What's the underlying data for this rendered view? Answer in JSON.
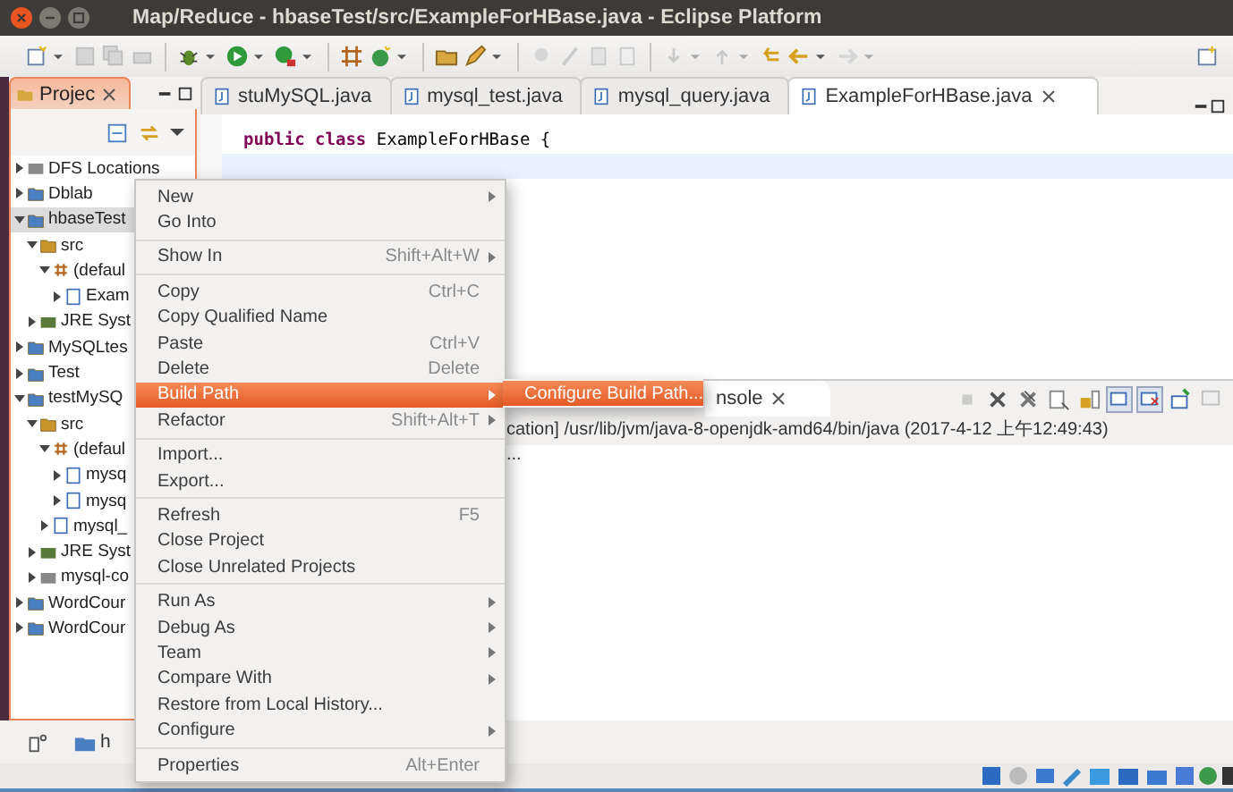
{
  "window": {
    "title": "Map/Reduce - hbaseTest/src/ExampleForHBase.java - Eclipse Platform"
  },
  "project_explorer": {
    "tab": {
      "label": "Projec",
      "selected": true
    },
    "tree": [
      {
        "label": "DFS Locations",
        "kind": "dfs",
        "expanded": false,
        "selected": false
      },
      {
        "label": "Dblab",
        "kind": "project",
        "expanded": false,
        "selected": false
      },
      {
        "label": "hbaseTest",
        "kind": "project",
        "expanded": true,
        "selected": true,
        "children": [
          {
            "label": "src",
            "kind": "source-folder",
            "expanded": true,
            "selected": false,
            "children": [
              {
                "label": "(defaul",
                "kind": "package",
                "expanded": true,
                "selected": false,
                "children": [
                  {
                    "label": "Exam",
                    "kind": "java-file",
                    "expanded": false,
                    "selected": false
                  }
                ]
              }
            ]
          },
          {
            "label": "JRE Syst",
            "kind": "library",
            "expanded": false,
            "selected": false
          }
        ]
      },
      {
        "label": "MySQLtes",
        "kind": "project",
        "expanded": false,
        "selected": false
      },
      {
        "label": "Test",
        "kind": "project",
        "expanded": false,
        "selected": false
      },
      {
        "label": "testMySQ",
        "kind": "project",
        "expanded": true,
        "selected": false,
        "children": [
          {
            "label": "src",
            "kind": "source-folder",
            "expanded": true,
            "selected": false,
            "children": [
              {
                "label": "(defaul",
                "kind": "package",
                "expanded": true,
                "selected": false,
                "children": [
                  {
                    "label": "mysq",
                    "kind": "java-file",
                    "expanded": false,
                    "selected": false
                  },
                  {
                    "label": "mysq",
                    "kind": "java-file",
                    "expanded": false,
                    "selected": false
                  }
                ]
              },
              {
                "label": "mysql_",
                "kind": "java-file",
                "expanded": false,
                "selected": false
              }
            ]
          },
          {
            "label": "JRE Syst",
            "kind": "library",
            "expanded": false,
            "selected": false
          },
          {
            "label": "mysql-co",
            "kind": "jar",
            "expanded": false,
            "selected": false
          }
        ]
      },
      {
        "label": "WordCour",
        "kind": "project",
        "expanded": false,
        "selected": false
      },
      {
        "label": "WordCour",
        "kind": "project",
        "expanded": false,
        "selected": false
      }
    ]
  },
  "editor": {
    "tabs": [
      {
        "label": "stuMySQL.java",
        "selected": false
      },
      {
        "label": "mysql_test.java",
        "selected": false
      },
      {
        "label": "mysql_query.java",
        "selected": false
      },
      {
        "label": "ExampleForHBase.java",
        "selected": true
      }
    ],
    "lines": [
      {
        "highlighted": false,
        "tokens": [
          {
            "text": "public",
            "kind": "keyword"
          },
          {
            "text": "class",
            "kind": "keyword"
          },
          {
            "text": "ExampleForHBase {",
            "kind": "plain"
          }
        ]
      },
      {
        "highlighted": true
      }
    ]
  },
  "console": {
    "tab": {
      "label": "nsole",
      "selected": true
    },
    "header": "cation] /usr/lib/jvm/java-8-openjdk-amd64/bin/java (2017-4-12 上午12:49:43)",
    "output": "..."
  },
  "status_bar": {
    "label": "h"
  },
  "context_menu": [
    {
      "kind": "item",
      "label": "New",
      "submenu": true,
      "selected": false
    },
    {
      "kind": "item",
      "label": "Go Into",
      "submenu": false,
      "selected": false
    },
    {
      "kind": "separator"
    },
    {
      "kind": "item",
      "label": "Show In",
      "shortcut": "Shift+Alt+W",
      "submenu": true,
      "selected": false
    },
    {
      "kind": "separator"
    },
    {
      "kind": "item",
      "label": "Copy",
      "shortcut": "Ctrl+C",
      "submenu": false,
      "selected": false
    },
    {
      "kind": "item",
      "label": "Copy Qualified Name",
      "submenu": false,
      "selected": false
    },
    {
      "kind": "item",
      "label": "Paste",
      "shortcut": "Ctrl+V",
      "submenu": false,
      "selected": false
    },
    {
      "kind": "item",
      "label": "Delete",
      "shortcut": "Delete",
      "submenu": false,
      "selected": false
    },
    {
      "kind": "item",
      "label": "Build Path",
      "submenu": true,
      "selected": true
    },
    {
      "kind": "item",
      "label": "Refactor",
      "shortcut": "Shift+Alt+T",
      "submenu": true,
      "selected": false
    },
    {
      "kind": "separator"
    },
    {
      "kind": "item",
      "label": "Import...",
      "submenu": false,
      "selected": false
    },
    {
      "kind": "item",
      "label": "Export...",
      "submenu": false,
      "selected": false
    },
    {
      "kind": "separator"
    },
    {
      "kind": "item",
      "label": "Refresh",
      "shortcut": "F5",
      "submenu": false,
      "selected": false
    },
    {
      "kind": "item",
      "label": "Close Project",
      "submenu": false,
      "selected": false
    },
    {
      "kind": "item",
      "label": "Close Unrelated Projects",
      "submenu": false,
      "selected": false
    },
    {
      "kind": "separator"
    },
    {
      "kind": "item",
      "label": "Run As",
      "submenu": true,
      "selected": false
    },
    {
      "kind": "item",
      "label": "Debug As",
      "submenu": true,
      "selected": false
    },
    {
      "kind": "item",
      "label": "Team",
      "submenu": true,
      "selected": false
    },
    {
      "kind": "item",
      "label": "Compare With",
      "submenu": true,
      "selected": false
    },
    {
      "kind": "item",
      "label": "Restore from Local History...",
      "submenu": false,
      "selected": false
    },
    {
      "kind": "item",
      "label": "Configure",
      "submenu": true,
      "selected": false
    },
    {
      "kind": "separator"
    },
    {
      "kind": "item",
      "label": "Properties",
      "shortcut": "Alt+Enter",
      "submenu": false,
      "selected": false
    }
  ],
  "submenu": [
    {
      "label": "Configure Build Path...",
      "selected": true
    }
  ]
}
